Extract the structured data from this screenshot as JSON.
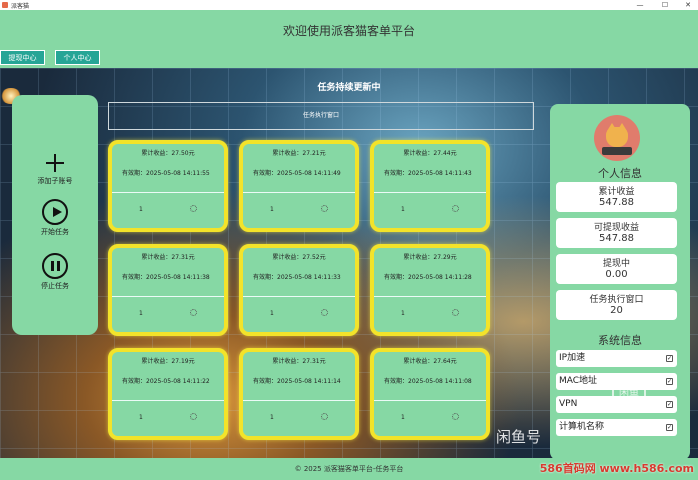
{
  "window": {
    "title": "派客猫",
    "minimize": "—",
    "maximize": "☐",
    "close": "✕"
  },
  "header": {
    "title": "欢迎使用派客猫客单平台"
  },
  "nav": {
    "tabs": [
      {
        "label": "提现中心"
      },
      {
        "label": "个人中心"
      }
    ]
  },
  "main": {
    "banner": "任务持续更新中",
    "exec_window_label": "任务执行窗口"
  },
  "sidebar": {
    "buttons": [
      {
        "label": "添加子账号"
      },
      {
        "label": "开始任务"
      },
      {
        "label": "停止任务"
      }
    ]
  },
  "tasks": [
    {
      "earn": "累计收益：27.50元",
      "valid": "有效期：2025-05-08 14:11:55",
      "count": "1"
    },
    {
      "earn": "累计收益：27.21元",
      "valid": "有效期：2025-05-08 14:11:49",
      "count": "1"
    },
    {
      "earn": "累计收益：27.44元",
      "valid": "有效期：2025-05-08 14:11:43",
      "count": "1"
    },
    {
      "earn": "累计收益：27.31元",
      "valid": "有效期：2025-05-08 14:11:38",
      "count": "1"
    },
    {
      "earn": "累计收益：27.52元",
      "valid": "有效期：2025-05-08 14:11:33",
      "count": "1"
    },
    {
      "earn": "累计收益：27.29元",
      "valid": "有效期：2025-05-08 14:11:28",
      "count": "1"
    },
    {
      "earn": "累计收益：27.19元",
      "valid": "有效期：2025-05-08 14:11:22",
      "count": "1"
    },
    {
      "earn": "累计收益：27.31元",
      "valid": "有效期：2025-05-08 14:11:14",
      "count": "1"
    },
    {
      "earn": "累计收益：27.64元",
      "valid": "有效期：2025-05-08 14:11:08",
      "count": "1"
    }
  ],
  "profile": {
    "heading": "个人信息",
    "stats": [
      {
        "label": "累计收益",
        "value": "547.88"
      },
      {
        "label": "可提现收益",
        "value": "547.88"
      },
      {
        "label": "提现中",
        "value": "0.00"
      },
      {
        "label": "任务执行窗口",
        "value": "20"
      }
    ]
  },
  "system": {
    "heading": "系统信息",
    "items": [
      {
        "label": "IP加速",
        "checked": "✓"
      },
      {
        "label": "MAC地址",
        "checked": "✓"
      },
      {
        "label": "VPN",
        "checked": "✓"
      },
      {
        "label": "计算机名称",
        "checked": "✓"
      }
    ]
  },
  "footer": {
    "text": "© 2025 派客猫客单平台-任务平台"
  },
  "watermarks": {
    "xianyu": "闲鱼号",
    "logo": "闲鱼",
    "site": "586首码网 www.h586.com"
  },
  "colors": {
    "accent_green": "#86d8a4",
    "tab_teal": "#26a596",
    "card_border": "#f3e32a"
  }
}
